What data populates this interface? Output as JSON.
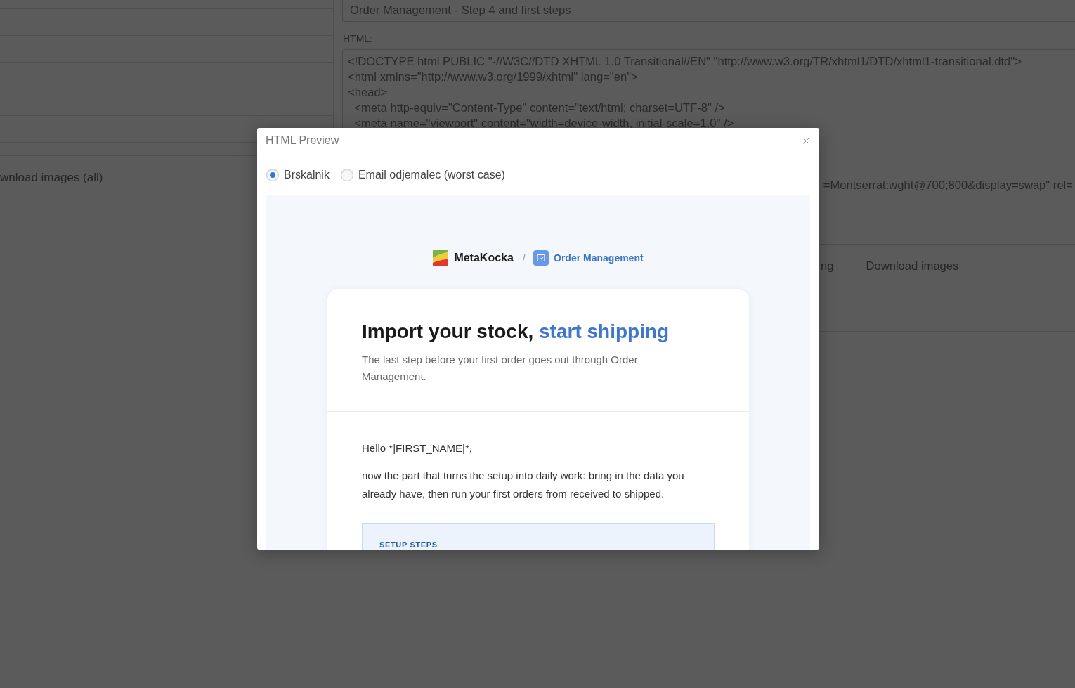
{
  "background": {
    "left_panel": {
      "link": "wnload images (all)"
    },
    "right_panel": {
      "subject_value": "Order Management - Step 4 and first steps",
      "html_label": "HTML:",
      "html_lines": [
        "<!DOCTYPE html PUBLIC \"-//W3C//DTD XHTML 1.0 Transitional//EN\" \"http://www.w3.org/TR/xhtml1/DTD/xhtml1-transitional.dtd\">",
        "<html xmlns=\"http://www.w3.org/1999/xhtml\" lang=\"en\">",
        "<head>",
        "  <meta http-equiv=\"Content-Type\" content=\"text/html; charset=UTF-8\" />",
        "  <meta name=\"viewport\" content=\"width=device-width, initial-scale=1.0\" />"
      ],
      "html_line_tail": "=Montserrat:wght@700;800&display=swap\" rel=",
      "actions": [
        "ng",
        "Download images"
      ]
    }
  },
  "dialog": {
    "title": "HTML Preview",
    "view_options": [
      {
        "label": "Brskalnik",
        "selected": true
      },
      {
        "label": "Email odjemalec (worst case)",
        "selected": false
      }
    ],
    "preview": {
      "brand": "MetaKocka",
      "separator": "/",
      "product": "Order Management",
      "heading": {
        "text": "Import your stock,",
        "highlight": "start shipping"
      },
      "subtitle": "The last step before your first order goes out through Order Management.",
      "greeting": "Hello *|FIRST_NAME|*,",
      "paragraph": "now the part that turns the setup into daily work: bring in the data you already have, then run your first orders from received to shipped.",
      "steps_title": "SETUP STEPS"
    }
  }
}
